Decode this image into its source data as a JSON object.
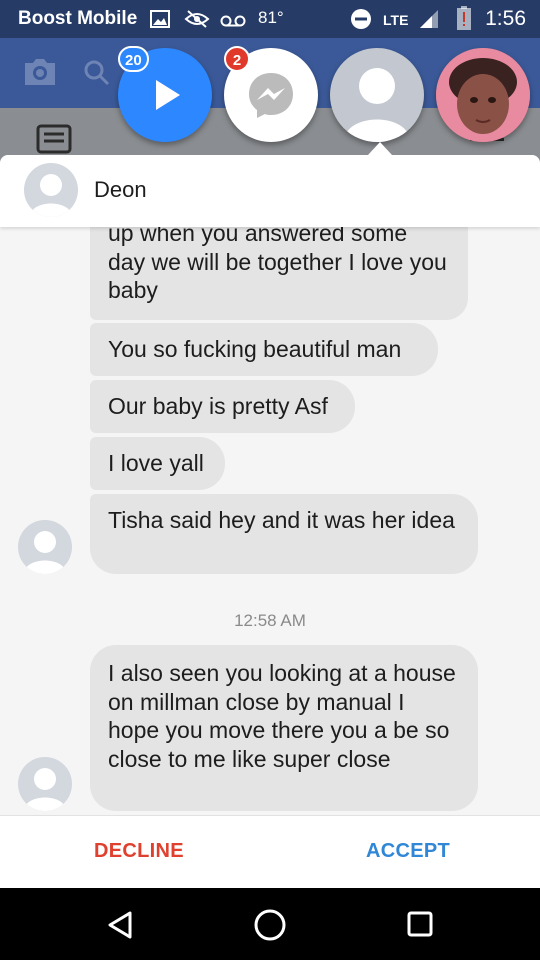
{
  "status_bar": {
    "carrier": "Boost Mobile",
    "temperature": "81°",
    "network": "LTE",
    "time": "1:56"
  },
  "chat_heads": {
    "video_badge": "20",
    "messenger_badge": "2"
  },
  "conversation": {
    "contact_name": "Deon",
    "messages": [
      "up when you answered some day we will be together I love you baby",
      "You so fucking beautiful man",
      "Our baby is pretty Asf",
      "I love yall",
      "Tisha said hey and it was her idea",
      "I also seen you looking at a house on millman close by manual I hope you move there you a be so close to me like super close"
    ],
    "timestamp": "12:58 AM"
  },
  "actions": {
    "decline_label": "DECLINE",
    "accept_label": "ACCEPT"
  },
  "colors": {
    "status_bar_bg": "#263c66",
    "facebook_blue": "#3b5998",
    "decline": "#e0402e",
    "accept": "#2f87d6",
    "badge_red": "#e0392b",
    "bubble_bg": "#e4e4e4"
  },
  "icons": [
    "image-icon",
    "eye-off-icon",
    "voicemail-icon",
    "do-not-disturb-icon",
    "signal-icon",
    "battery-alert-icon",
    "camera-icon",
    "search-icon",
    "play-icon",
    "messenger-icon",
    "back-icon",
    "home-icon",
    "recents-icon"
  ]
}
